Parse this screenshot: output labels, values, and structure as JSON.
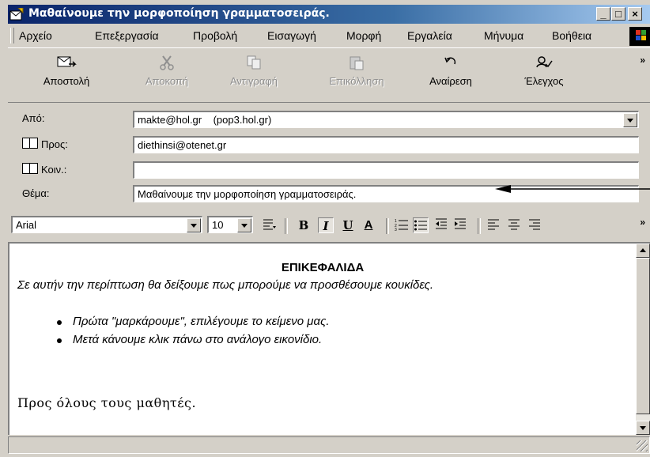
{
  "window": {
    "title": "Μαθαίνουμε την μορφοποίηση γραμματοσειράς.",
    "minimize": "_",
    "maximize": "□",
    "close": "×"
  },
  "menu": {
    "items": [
      "Αρχείο",
      "Επεξεργασία",
      "Προβολή",
      "Εισαγωγή",
      "Μορφή",
      "Εργαλεία",
      "Μήνυμα",
      "Βοήθεια"
    ]
  },
  "toolbar": {
    "send": "Αποστολή",
    "cut": "Αποκοπή",
    "copy": "Αντιγραφή",
    "paste": "Επικόλληση",
    "undo": "Αναίρεση",
    "check": "Έλεγχος",
    "more": "»"
  },
  "header": {
    "from_label": "Από:",
    "from_value": "makte@hol.gr    (pop3.hol.gr)",
    "to_label": "Προς:",
    "to_value": "diethinsi@otenet.gr",
    "cc_label": "Κοιν.:",
    "cc_value": "",
    "subject_label": "Θέμα:",
    "subject_value": "Μαθαίνουμε την μορφοποίηση γραμματοσειράς."
  },
  "format": {
    "font": "Arial",
    "size": "10",
    "bold": "B",
    "italic": "I",
    "underline": "U",
    "font_color": "A",
    "more": "»"
  },
  "body": {
    "heading": "ΕΠΙΚΕΦΑΛΙΔΑ",
    "intro": "Σε αυτήν την περίπτωση θα δείξουμε πως μπορούμε να προσθέσουμε κουκίδες.",
    "bullets": [
      "Πρώτα \"μαρκάρουμε\", επιλέγουμε το κείμενο μας.",
      "Μετά κάνουμε κλικ πάνω στο ανάλογο εικονίδιο."
    ],
    "closing": "Προς όλους τους μαθητές."
  },
  "colors": {
    "titlebar_start": "#0a246a",
    "titlebar_end": "#a6caf0",
    "chrome": "#d4d0c8"
  }
}
